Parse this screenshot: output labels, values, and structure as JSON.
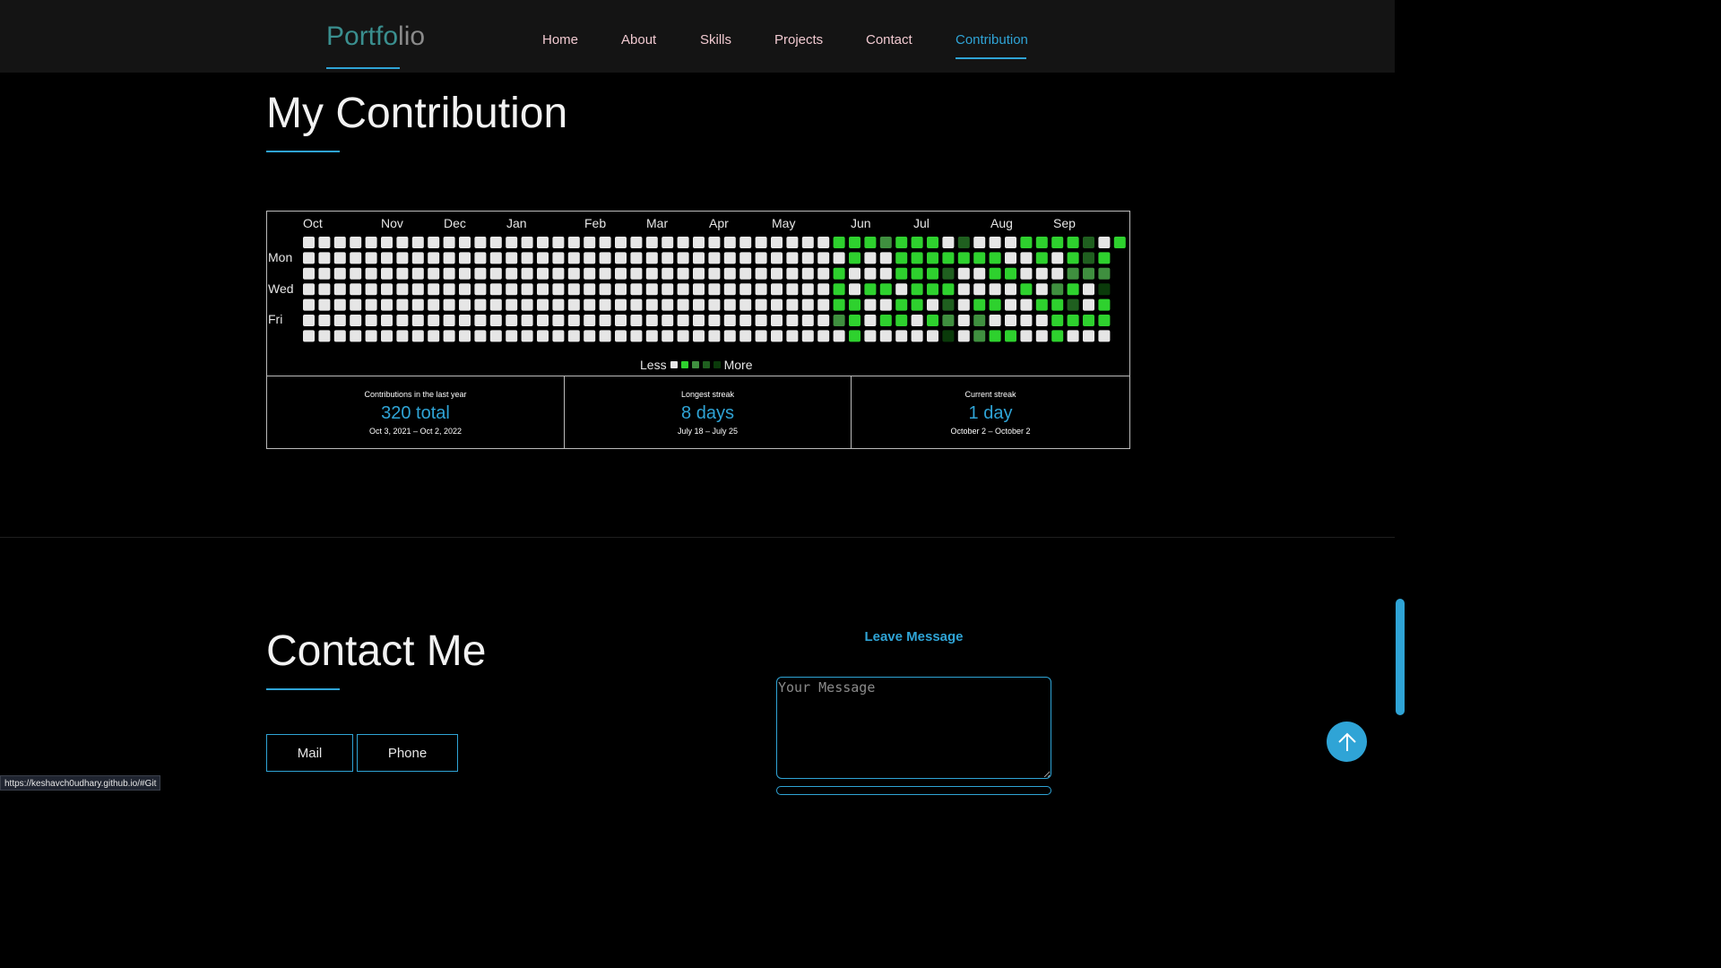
{
  "nav": {
    "logo_part1": "Portfo",
    "logo_part2": "lio",
    "items": [
      "Home",
      "About",
      "Skills",
      "Projects",
      "Contact",
      "Contribution"
    ],
    "active": "Contribution"
  },
  "contribution": {
    "title": "My Contribution",
    "months": [
      "Oct",
      "Nov",
      "Dec",
      "Jan",
      "Feb",
      "Mar",
      "Apr",
      "May",
      "Jun",
      "Jul",
      "Aug",
      "Sep"
    ],
    "weekdays": [
      "Mon",
      "Wed",
      "Fri"
    ],
    "legend_less": "Less",
    "legend_more": "More",
    "level_colors": [
      "#e6e6e6",
      "#2ed12e",
      "#3f8f3f",
      "#1f5f1f",
      "#0a3a0a"
    ],
    "weeks": 53,
    "active_cells": [
      [
        34,
        0,
        1
      ],
      [
        34,
        2,
        1
      ],
      [
        34,
        3,
        1
      ],
      [
        34,
        4,
        1
      ],
      [
        34,
        5,
        2
      ],
      [
        35,
        0,
        1
      ],
      [
        35,
        1,
        1
      ],
      [
        35,
        4,
        1
      ],
      [
        35,
        5,
        1
      ],
      [
        35,
        6,
        1
      ],
      [
        36,
        0,
        1
      ],
      [
        36,
        3,
        1
      ],
      [
        37,
        0,
        2
      ],
      [
        37,
        3,
        1
      ],
      [
        37,
        5,
        1
      ],
      [
        38,
        0,
        1
      ],
      [
        38,
        1,
        1
      ],
      [
        38,
        2,
        1
      ],
      [
        38,
        4,
        1
      ],
      [
        38,
        5,
        1
      ],
      [
        39,
        0,
        1
      ],
      [
        39,
        1,
        1
      ],
      [
        39,
        2,
        1
      ],
      [
        39,
        3,
        1
      ],
      [
        39,
        4,
        1
      ],
      [
        40,
        0,
        1
      ],
      [
        40,
        1,
        1
      ],
      [
        40,
        2,
        1
      ],
      [
        40,
        3,
        1
      ],
      [
        40,
        5,
        1
      ],
      [
        41,
        1,
        1
      ],
      [
        41,
        2,
        3
      ],
      [
        41,
        3,
        1
      ],
      [
        41,
        4,
        3
      ],
      [
        41,
        5,
        2
      ],
      [
        41,
        6,
        4
      ],
      [
        42,
        0,
        3
      ],
      [
        42,
        1,
        1
      ],
      [
        43,
        1,
        1
      ],
      [
        43,
        4,
        1
      ],
      [
        43,
        5,
        2
      ],
      [
        43,
        6,
        2
      ],
      [
        44,
        1,
        1
      ],
      [
        44,
        2,
        1
      ],
      [
        44,
        4,
        1
      ],
      [
        44,
        6,
        1
      ],
      [
        45,
        2,
        1
      ],
      [
        45,
        6,
        1
      ],
      [
        46,
        0,
        1
      ],
      [
        46,
        3,
        1
      ],
      [
        47,
        0,
        1
      ],
      [
        47,
        1,
        1
      ],
      [
        47,
        4,
        1
      ],
      [
        48,
        0,
        1
      ],
      [
        48,
        3,
        2
      ],
      [
        48,
        4,
        1
      ],
      [
        48,
        5,
        1
      ],
      [
        48,
        6,
        1
      ],
      [
        49,
        0,
        1
      ],
      [
        49,
        1,
        1
      ],
      [
        49,
        2,
        2
      ],
      [
        49,
        3,
        1
      ],
      [
        49,
        4,
        3
      ],
      [
        49,
        5,
        1
      ],
      [
        50,
        0,
        3
      ],
      [
        50,
        1,
        3
      ],
      [
        50,
        2,
        2
      ],
      [
        50,
        5,
        1
      ],
      [
        51,
        1,
        1
      ],
      [
        51,
        2,
        2
      ],
      [
        51,
        3,
        4
      ],
      [
        51,
        4,
        1
      ],
      [
        51,
        5,
        1
      ],
      [
        52,
        0,
        1
      ]
    ],
    "stats": [
      {
        "label": "Contributions in the last year",
        "value": "320 total",
        "range": "Oct 3, 2021 – Oct 2, 2022"
      },
      {
        "label": "Longest streak",
        "value": "8 days",
        "range": "July 18 – July 25"
      },
      {
        "label": "Current streak",
        "value": "1 day",
        "range": "October 2 – October 2"
      }
    ]
  },
  "contact": {
    "title": "Contact Me",
    "mail_label": "Mail",
    "phone_label": "Phone",
    "leave_message": "Leave Message",
    "message_placeholder": "Your Message"
  },
  "status_url": "https://keshavch0udhary.github.io/#Git",
  "accent": "#2fa4d6"
}
